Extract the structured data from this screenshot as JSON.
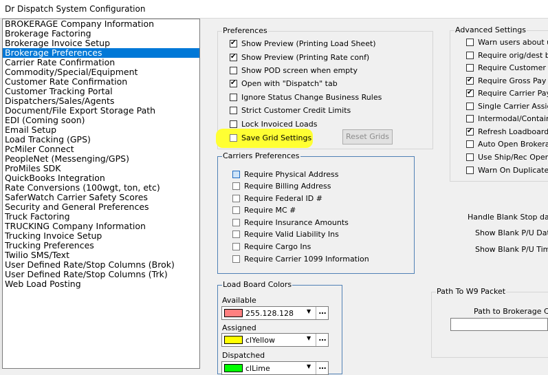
{
  "window": {
    "title": "Dr Dispatch  System Configuration"
  },
  "nav": {
    "items": [
      "BROKERAGE Company Information",
      "Brokerage Factoring",
      "Brokerage Invoice Setup",
      "Brokerage Preferences",
      "Carrier Rate Confirmation",
      "Commodity/Special/Equipment",
      "Customer Rate Confirmation",
      "Customer Tracking Portal",
      "Dispatchers/Sales/Agents",
      "Document/File Export Storage Path",
      "EDI (Coming soon)",
      "Email Setup",
      "Load Tracking (GPS)",
      "PcMiler Connect",
      "PeopleNet (Messenging/GPS)",
      "ProMiles SDK",
      "QuickBooks Integration",
      "Rate Conversions (100wgt, ton, etc)",
      "SaferWatch Carrier Safety Scores",
      "Security and General Preferences",
      "Truck Factoring",
      "TRUCKING Company Information",
      "Trucking Invoice Setup",
      "Trucking Preferences",
      "Twilio SMS/Text",
      "User Defined Rate/Stop Columns (Brok)",
      "User Defined Rate/Stop Columns (Trk)",
      "Web Load Posting"
    ],
    "selected": "Brokerage Preferences"
  },
  "preferences": {
    "caption": "Preferences",
    "options": [
      {
        "label": "Show Preview (Printing Load Sheet)",
        "checked": true
      },
      {
        "label": "Show Preview (Printing Rate conf)",
        "checked": true
      },
      {
        "label": "Show POD screen when empty",
        "checked": false
      },
      {
        "label": "Open with \"Dispatch\" tab",
        "checked": true
      },
      {
        "label": "Ignore Status Change Business Rules",
        "checked": false
      },
      {
        "label": "Strict Customer Credit Limits",
        "checked": false
      },
      {
        "label": "Lock Invoiced Loads",
        "checked": false
      },
      {
        "label": "Save Grid Settings",
        "checked": false
      }
    ],
    "reset_grids_label": "Reset Grids"
  },
  "carriers": {
    "caption": "Carriers Preferences",
    "options": [
      {
        "label": "Require Physical Address",
        "checked": false
      },
      {
        "label": "Require Billing Address",
        "checked": false
      },
      {
        "label": "Require Federal ID #",
        "checked": false
      },
      {
        "label": "Require MC #",
        "checked": false
      },
      {
        "label": "Require Insurance Amounts",
        "checked": false
      },
      {
        "label": "Require Valid Liability Ins",
        "checked": false
      },
      {
        "label": "Require Cargo Ins",
        "checked": false
      },
      {
        "label": "Require Carrier 1099 Information",
        "checked": false
      }
    ]
  },
  "advanced": {
    "caption": "Advanced Settings",
    "options": [
      {
        "label": "Warn users about un-",
        "checked": false
      },
      {
        "label": "Require orig/dest befo",
        "checked": false
      },
      {
        "label": "Require Customer Ref",
        "checked": false
      },
      {
        "label": "Require Gross Pay On",
        "checked": true
      },
      {
        "label": "Require Carrier Pay O",
        "checked": true
      },
      {
        "label": "Single Carrier Assignm",
        "checked": false
      },
      {
        "label": "Intermodal/Container",
        "checked": false
      },
      {
        "label": "Refresh Loadboard or",
        "checked": true
      },
      {
        "label": "Auto Open Brokerage",
        "checked": false
      },
      {
        "label": "Use Ship/Rec Open Tir",
        "checked": false
      },
      {
        "label": "Warn On Duplicate Lo",
        "checked": false
      }
    ]
  },
  "blank_stop": {
    "caption": "Handle Blank Stop dates",
    "dates_label": "Show Blank P/U Dates",
    "times_label": "Show Blank P/U Times"
  },
  "load_board_colors": {
    "caption": "Load Board Colors",
    "available": {
      "label": "Available",
      "value": "255.128.128",
      "color": "#ff8080"
    },
    "assigned": {
      "label": "Assigned",
      "value": "clYellow",
      "color": "#ffff00"
    },
    "dispatched": {
      "label": "Dispatched",
      "value": "clLime",
      "color": "#00ff00"
    },
    "dropdown_symbol": "▼",
    "ellipsis_symbol": "…"
  },
  "w9": {
    "caption": "Path To W9 Packet",
    "path_label": "Path to Brokerage Con"
  }
}
